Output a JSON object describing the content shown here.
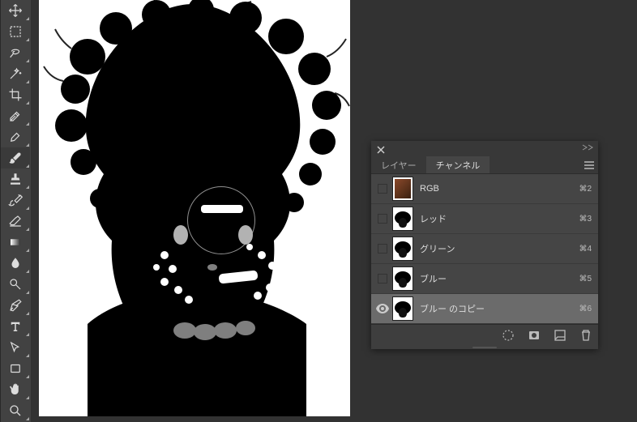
{
  "tools": [
    "move",
    "marquee",
    "lasso",
    "magic-wand",
    "crop",
    "eyedropper",
    "patch",
    "brush",
    "stamp",
    "history-brush",
    "eraser",
    "gradient",
    "sharpen",
    "smudge",
    "pen",
    "type",
    "path-select",
    "rectangle",
    "hand",
    "zoom"
  ],
  "panel": {
    "tabs": {
      "layers": "レイヤー",
      "channels": "チャンネル"
    },
    "channels": [
      {
        "name": "RGB",
        "shortcut": "⌘2",
        "visible": false,
        "color": true,
        "selected": false
      },
      {
        "name": "レッド",
        "shortcut": "⌘3",
        "visible": false,
        "color": false,
        "selected": false
      },
      {
        "name": "グリーン",
        "shortcut": "⌘4",
        "visible": false,
        "color": false,
        "selected": false
      },
      {
        "name": "ブルー",
        "shortcut": "⌘5",
        "visible": false,
        "color": false,
        "selected": false
      },
      {
        "name": "ブルー のコピー",
        "shortcut": "⌘6",
        "visible": true,
        "color": false,
        "selected": true
      }
    ]
  }
}
